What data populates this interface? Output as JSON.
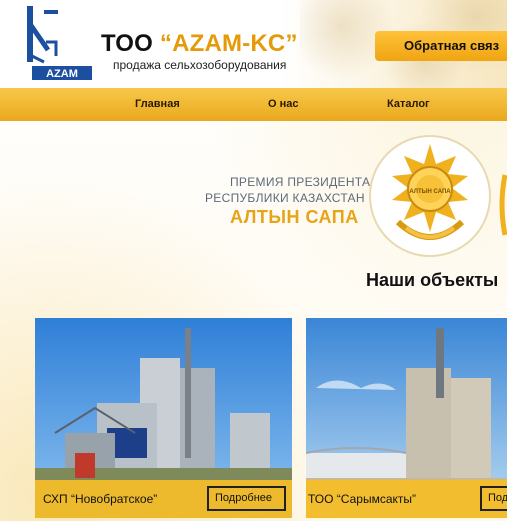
{
  "header": {
    "logo_text": "AZAM",
    "company_prefix": "ТОО",
    "company_brand": "“AZAM-KC”",
    "tagline": "продажа сельхозоборудования",
    "contact_button": "Обратная связ"
  },
  "nav": {
    "items": [
      {
        "label": "Главная"
      },
      {
        "label": "О нас"
      },
      {
        "label": "Каталог"
      }
    ]
  },
  "award": {
    "line1": "ПРЕМИЯ ПРЕЗИДЕНТА",
    "line2": "РЕСПУБЛИКИ КАЗАХСТАН",
    "title": "АЛТЫН САПА",
    "badge_text": "АЛТЫН САПА"
  },
  "objects": {
    "title": "Наши объекты",
    "cards": [
      {
        "caption": "СХП “Новобратское”",
        "button": "Подробнее"
      },
      {
        "caption": "ТОО “Сарымсакты”",
        "button": "Подробнее"
      }
    ]
  },
  "colors": {
    "accent": "#f5b326",
    "brand": "#e59a0a",
    "award_text": "#e8a417",
    "logo_blue": "#1c4fa0"
  }
}
